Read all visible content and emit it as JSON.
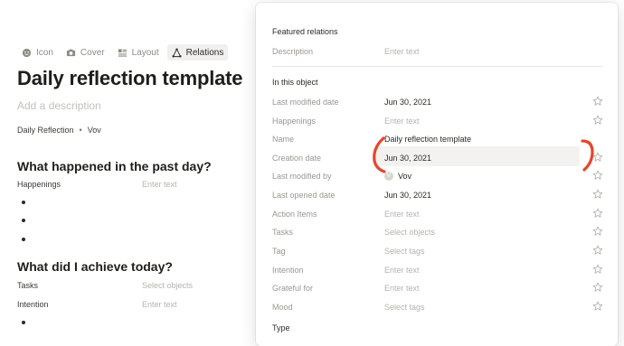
{
  "editor": {
    "toolbar": [
      {
        "label": "Icon",
        "icon": "smiley-icon"
      },
      {
        "label": "Cover",
        "icon": "camera-icon"
      },
      {
        "label": "Layout",
        "icon": "layout-icon"
      },
      {
        "label": "Relations",
        "icon": "relations-icon"
      }
    ],
    "title": "Daily reflection template",
    "description_placeholder": "Add a description",
    "meta": {
      "type": "Daily Reflection",
      "separator": "•",
      "author": "Vov"
    },
    "section1_heading": "What happened in the past day?",
    "happenings_label": "Happenings",
    "happenings_value": "Enter text",
    "section2_heading": "What did I achieve today?",
    "tasks_label": "Tasks",
    "tasks_value": "Select objects",
    "intention_label": "Intention",
    "intention_value": "Enter text"
  },
  "panel": {
    "featured_title": "Featured relations",
    "featured": [
      {
        "label": "Description",
        "value": "Enter text"
      }
    ],
    "in_object_title": "In this object",
    "relations": [
      {
        "label": "Last modified date",
        "value": "Jun 30, 2021",
        "filled": true
      },
      {
        "label": "Happenings",
        "value": "Enter text",
        "filled": false
      },
      {
        "label": "Name",
        "value": "Daily reflection template",
        "filled": true
      },
      {
        "label": "Creation date",
        "value": "Jun 30, 2021",
        "filled": true
      },
      {
        "label": "Last modified by",
        "value": "Vov",
        "filled": true,
        "avatar": "V"
      },
      {
        "label": "Last opened date",
        "value": "Jun 30, 2021",
        "filled": true
      },
      {
        "label": "Action Items",
        "value": "Enter text",
        "filled": false
      },
      {
        "label": "Tasks",
        "value": "Select objects",
        "filled": false
      },
      {
        "label": "Tag",
        "value": "Select tags",
        "filled": false
      },
      {
        "label": "Intention",
        "value": "Enter text",
        "filled": false
      },
      {
        "label": "Grateful for",
        "value": "Enter text",
        "filled": false
      },
      {
        "label": "Mood",
        "value": "Select tags",
        "filled": false
      }
    ],
    "type_title": "Type"
  },
  "colors": {
    "annotation_red": "#e8452c",
    "star_outline": "#b6b3ac",
    "highlight": "#f3f2f0"
  }
}
